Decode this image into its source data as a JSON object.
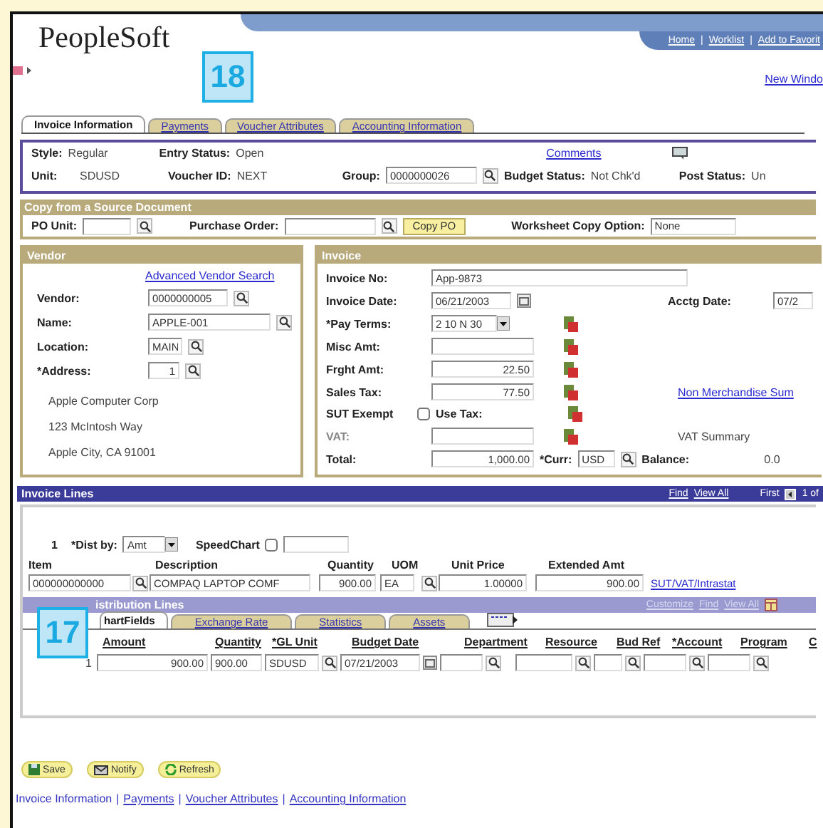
{
  "header": {
    "logo": "PeopleSoft",
    "nav_links": [
      "Home",
      "Worklist",
      "Add to Favorit"
    ],
    "separator": "|",
    "new_window": "New Windo"
  },
  "callouts": [
    "18",
    "17"
  ],
  "tabs": [
    {
      "label": "Invoice Information",
      "selected": true
    },
    {
      "label": "Payments",
      "selected": false
    },
    {
      "label": "Voucher Attributes",
      "selected": false
    },
    {
      "label": "Accounting Information",
      "selected": false
    }
  ],
  "summary": {
    "style_label": "Style:",
    "style": "Regular",
    "entry_status_label": "Entry Status:",
    "entry_status": "Open",
    "comments": "Comments",
    "unit_label": "Unit:",
    "unit": "SDUSD",
    "voucher_id_label": "Voucher ID:",
    "voucher_id": "NEXT",
    "group_label": "Group:",
    "group": "0000000026",
    "budget_status_label": "Budget Status:",
    "budget_status": "Not Chk'd",
    "post_status_label": "Post Status:",
    "post_status": "Un"
  },
  "copy_source": {
    "title": "Copy from a Source Document",
    "po_unit_label": "PO Unit:",
    "purchase_order_label": "Purchase Order:",
    "copy_po": "Copy PO",
    "worksheet_label": "Worksheet Copy Option:",
    "worksheet_value": "None"
  },
  "vendor": {
    "title": "Vendor",
    "advanced_search": "Advanced Vendor Search",
    "fields": [
      {
        "label": "Vendor:",
        "value": "0000000005"
      },
      {
        "label": "Name:",
        "value": "APPLE-001"
      },
      {
        "label": "Location:",
        "value": "MAIN"
      },
      {
        "label": "*Address:",
        "value": "1"
      }
    ],
    "address_lines": [
      "Apple Computer Corp",
      "123 McIntosh Way",
      "Apple City, CA 91001"
    ]
  },
  "invoice": {
    "title": "Invoice",
    "rows": [
      {
        "kind": "text",
        "label": "Invoice No:",
        "value": "App-9873"
      },
      {
        "kind": "date",
        "label": "Invoice Date:",
        "value": "06/21/2003",
        "side_label": "Acctg Date:",
        "side_value": "07/2"
      },
      {
        "kind": "select",
        "label": "*Pay Terms:",
        "value": "2 10 N 30"
      },
      {
        "kind": "amount",
        "label": "Misc Amt:",
        "disabled": false
      },
      {
        "kind": "amount",
        "label": "Frght Amt:",
        "value": "22.50",
        "disabled": false
      },
      {
        "kind": "amount",
        "label": "Sales Tax:",
        "value": "77.50",
        "disabled": false,
        "side_link": "Non Merchandise Sum"
      },
      {
        "kind": "checkbox",
        "label": "SUT Exempt",
        "checked": false,
        "extra_label": "Use Tax:"
      },
      {
        "kind": "amount",
        "label": "VAT:",
        "disabled": true,
        "side_text": "VAT Summary"
      },
      {
        "kind": "total",
        "label": "Total:",
        "value": "1,000.00",
        "currency_label": "*Curr:",
        "currency": "USD",
        "balance_label": "Balance:",
        "balance": "0.0"
      }
    ]
  },
  "invoice_lines": {
    "title": "Invoice Lines",
    "nav": [
      "Find",
      "View All"
    ],
    "first": "First",
    "page": "1 of",
    "line_number": "1",
    "dist_by_label": "*Dist by:",
    "dist_by": "Amt",
    "speedchart_label": "SpeedChart",
    "speedchart_checked": false,
    "columns": [
      "Item",
      "Description",
      "Quantity",
      "UOM",
      "Unit Price",
      "Extended Amt"
    ],
    "row": {
      "item": "000000000000",
      "description": "COMPAQ LAPTOP COMF",
      "quantity": "900.00",
      "uom": "EA",
      "unit_price": "1.00000",
      "extended_amt": "900.00"
    },
    "link": "SUT/VAT/Intrastat"
  },
  "distribution": {
    "title": "istribution Lines",
    "nav": [
      "Customize",
      "Find",
      "View All"
    ],
    "tabs": [
      {
        "label": "hartFields",
        "selected": true
      },
      {
        "label": "Exchange Rate",
        "selected": false
      },
      {
        "label": "Statistics",
        "selected": false
      },
      {
        "label": "Assets",
        "selected": false
      }
    ],
    "columns": [
      "Amount",
      "Quantity",
      "*GL Unit",
      "Budget Date",
      "Department",
      "Resource",
      "Bud Ref",
      "*Account",
      "Program",
      "C"
    ],
    "row": {
      "line": "1",
      "amount": "900.00",
      "quantity": "900.00",
      "gl_unit": "SDUSD",
      "budget_date": "07/21/2003"
    }
  },
  "footer": {
    "buttons": [
      "Save",
      "Notify",
      "Refresh"
    ],
    "separator": "|",
    "links": [
      {
        "label": "Invoice Information",
        "selected": true
      },
      {
        "label": "Payments",
        "selected": false
      },
      {
        "label": "Voucher Attributes",
        "selected": false
      },
      {
        "label": "Accounting Information",
        "selected": false
      }
    ]
  }
}
